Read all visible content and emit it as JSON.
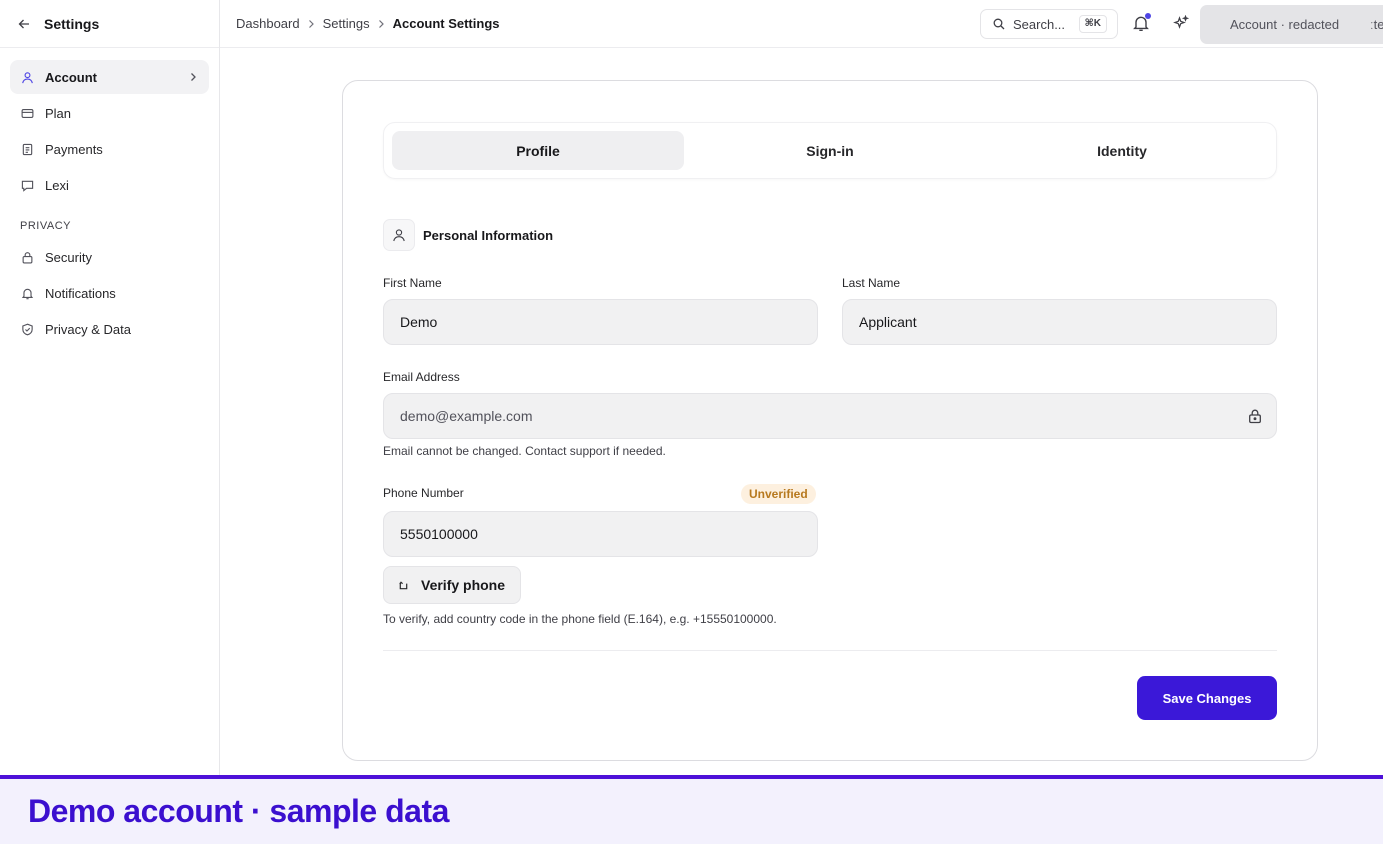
{
  "sidebar": {
    "title": "Settings",
    "items": [
      {
        "label": "Account",
        "icon": "user-icon",
        "active": true
      },
      {
        "label": "Plan",
        "icon": "credit-card-icon"
      },
      {
        "label": "Payments",
        "icon": "receipt-icon"
      },
      {
        "label": "Lexi",
        "icon": "message-icon"
      }
    ],
    "section_label": "PRIVACY",
    "privacy_items": [
      {
        "label": "Security",
        "icon": "lock-icon"
      },
      {
        "label": "Notifications",
        "icon": "bell-icon"
      },
      {
        "label": "Privacy & Data",
        "icon": "shield-icon"
      }
    ]
  },
  "header": {
    "breadcrumbs": [
      "Dashboard",
      "Settings",
      "Account Settings"
    ],
    "search_placeholder": "Search...",
    "search_shortcut": "⌘K",
    "account_label": "Account · redacted",
    "account_trail": "ːte",
    "accent_color": "#4f46e5"
  },
  "tabs": [
    "Profile",
    "Sign-in",
    "Identity"
  ],
  "active_tab": "Profile",
  "section": {
    "title": "Personal Information"
  },
  "form": {
    "first_name_label": "First Name",
    "first_name_value": "Demo",
    "last_name_label": "Last Name",
    "last_name_value": "Applicant",
    "email_label": "Email Address",
    "email_value": "demo@example.com",
    "email_help": "Email cannot be changed. Contact support if needed.",
    "phone_label": "Phone Number",
    "phone_badge": "Unverified",
    "phone_value": "5550100000",
    "verify_label": "Verify phone",
    "phone_help": "To verify, add country code in the phone field (E.164), e.g. +15550100000.",
    "save_label": "Save Changes"
  },
  "banner": {
    "text": "Demo account · sample data",
    "color": "#3b0fcf"
  }
}
